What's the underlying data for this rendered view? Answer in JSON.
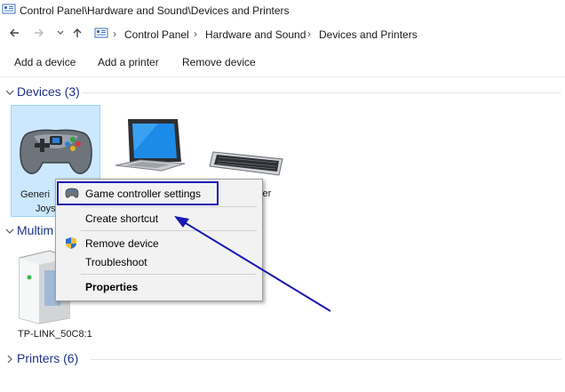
{
  "window": {
    "title": "Control Panel\\Hardware and Sound\\Devices and Printers"
  },
  "nav": {
    "back_icon": "back-arrow-icon",
    "forward_icon": "forward-arrow-icon",
    "recent_icon": "chevron-down-icon",
    "up_icon": "up-arrow-icon",
    "breadcrumbs": [
      "Control Panel",
      "Hardware and Sound",
      "Devices and Printers"
    ]
  },
  "commands": {
    "add_device": "Add a device",
    "add_printer": "Add a printer",
    "remove_device": "Remove device"
  },
  "groups": {
    "devices": {
      "title": "Devices (3)"
    },
    "multimedia": {
      "title": "Multim"
    },
    "printers": {
      "title": "Printers (6)"
    }
  },
  "devices": {
    "joystick": {
      "line1": "Generi",
      "line2": "Joys"
    },
    "keyboard": {
      "label_fragment": "ver"
    },
    "router": {
      "label": "TP-LINK_50C8:1"
    }
  },
  "context_menu": {
    "items": [
      {
        "label": "Game controller settings",
        "icon": "gamepad-icon"
      },
      {
        "label": "Create shortcut"
      },
      {
        "label": "Remove device",
        "icon": "shield-icon"
      },
      {
        "label": "Troubleshoot"
      },
      {
        "label": "Properties",
        "bold": true
      }
    ]
  },
  "colors": {
    "annotation": "#1a1ab3",
    "group_title": "#1e3287",
    "selection": "#cce8ff"
  }
}
